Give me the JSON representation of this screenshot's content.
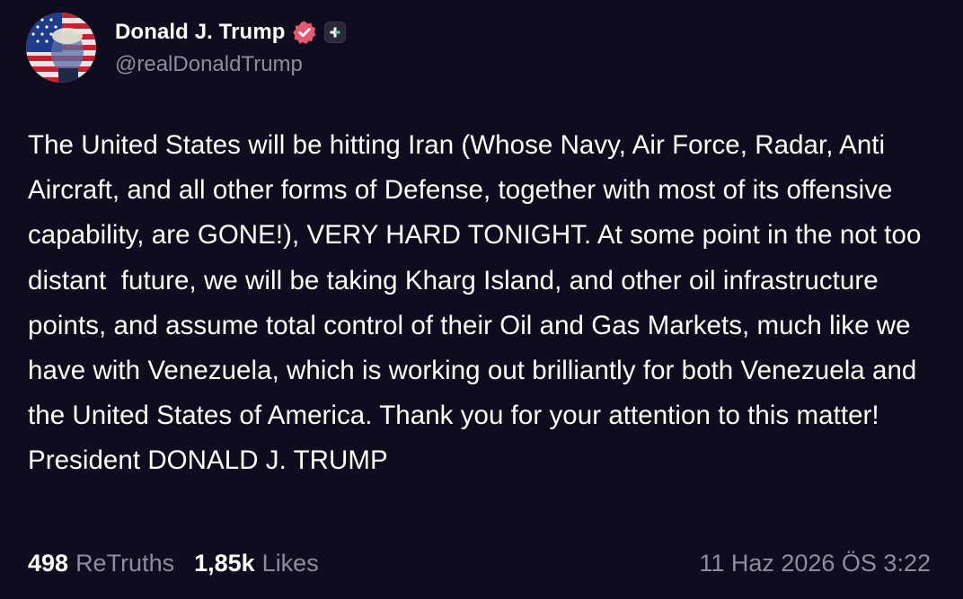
{
  "author": {
    "display_name": "Donald J. Trump",
    "handle": "@realDonaldTrump",
    "verified_color": "#e8596f",
    "verified_icon": "verified-badge-icon",
    "plus_icon": "plus-badge-icon"
  },
  "post": {
    "text": "The United States will be hitting Iran (Whose Navy, Air Force, Radar, Anti Aircraft, and all other forms of Defense, together with most of its offensive capability, are GONE!), VERY HARD TONIGHT. At some point in the not too distant  future, we will be taking Kharg Island, and other oil infrastructure points, and assume total control of their Oil and Gas Markets, much like we have with Venezuela, which is working out brilliantly for both Venezuela and the United States of America. Thank you for your attention to this matter! President DONALD J. TRUMP"
  },
  "stats": {
    "retruths_count": "498",
    "retruths_label": "ReTruths",
    "likes_count": "1,85k",
    "likes_label": "Likes"
  },
  "timestamp": "11 Haz 2026 ÖS 3:22",
  "colors": {
    "background": "#0f0c1f",
    "text": "#ffffff",
    "muted": "#8f8c9c"
  }
}
